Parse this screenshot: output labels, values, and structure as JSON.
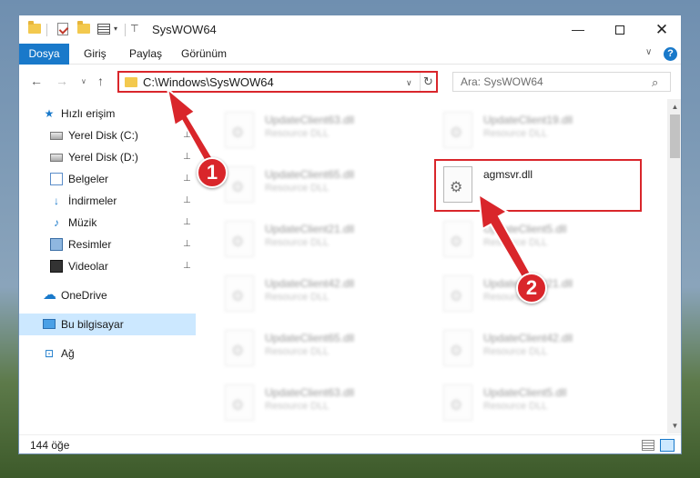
{
  "window": {
    "title": "SysWOW64",
    "controls": {
      "minimize": "—",
      "maximize": "",
      "close": "✕"
    }
  },
  "ribbon": {
    "tabs": [
      "Dosya",
      "Giriş",
      "Paylaş",
      "Görünüm"
    ],
    "expand_glyph": "∨",
    "help": "?"
  },
  "nav": {
    "back": "←",
    "forward": "→",
    "recent": "∨",
    "up": "↑",
    "address": "C:\\Windows\\SysWOW64",
    "address_drop": "∨",
    "refresh": "↻",
    "search_placeholder": "Ara: SysWOW64",
    "search_glyph": "⌕"
  },
  "sidebar": {
    "items": [
      {
        "label": "Hızlı erişim",
        "icon": "star-icon",
        "pinned": false
      },
      {
        "label": "Yerel Disk (C:)",
        "icon": "drive-icon",
        "pinned": true
      },
      {
        "label": "Yerel Disk (D:)",
        "icon": "drive-icon",
        "pinned": true
      },
      {
        "label": "Belgeler",
        "icon": "documents-icon",
        "pinned": true
      },
      {
        "label": "İndirmeler",
        "icon": "downloads-icon",
        "pinned": true
      },
      {
        "label": "Müzik",
        "icon": "music-icon",
        "pinned": true
      },
      {
        "label": "Resimler",
        "icon": "pictures-icon",
        "pinned": true
      },
      {
        "label": "Videolar",
        "icon": "videos-icon",
        "pinned": true
      },
      {
        "label": "OneDrive",
        "icon": "cloud-icon",
        "pinned": false
      },
      {
        "label": "Bu bilgisayar",
        "icon": "computer-icon",
        "pinned": false,
        "selected": true
      },
      {
        "label": "Ağ",
        "icon": "network-icon",
        "pinned": false
      }
    ],
    "pin_glyph": "📌"
  },
  "files": {
    "left": [
      {
        "name": "UpdateClient63.dll",
        "type": "Resource DLL"
      },
      {
        "name": "UpdateClient65.dll",
        "type": "Resource DLL"
      },
      {
        "name": "UpdateClient21.dll",
        "type": "Resource DLL"
      },
      {
        "name": "UpdateClient42.dll",
        "type": "Resource DLL"
      },
      {
        "name": "UpdateClient65.dll",
        "type": "Resource DLL"
      },
      {
        "name": "UpdateClient63.dll",
        "type": "Resource DLL"
      }
    ],
    "right": [
      {
        "name": "UpdateClient19.dll",
        "type": "Resource DLL"
      },
      {
        "name": "UpdateClient5.dll",
        "type": "Resource DLL"
      },
      {
        "name": "UpdateClient21.dll",
        "type": "Resource DLL"
      },
      {
        "name": "UpdateClient42.dll",
        "type": "Resource DLL"
      },
      {
        "name": "UpdateClient5.dll",
        "type": "Resource DLL"
      }
    ],
    "highlighted": {
      "name": "agmsvr.dll"
    }
  },
  "status": {
    "count": "144 öğe"
  },
  "annotations": {
    "step1": "1",
    "step2": "2",
    "color": "#d9262b"
  }
}
